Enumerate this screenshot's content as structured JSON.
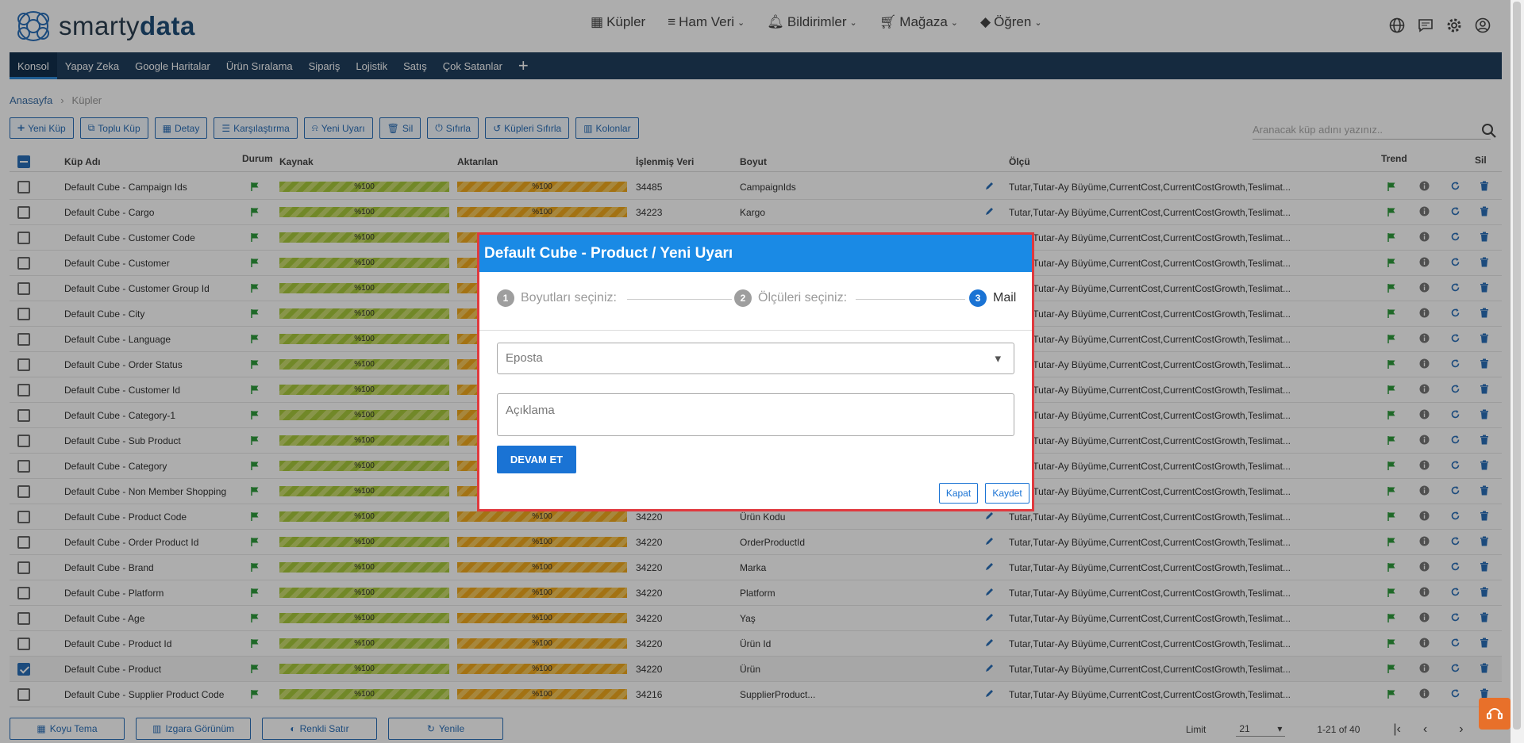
{
  "brand": {
    "logo_light": "smarty",
    "logo_bold": "data"
  },
  "topnav": [
    {
      "icon": "grid-icon",
      "label": "Küpler",
      "dropdown": false
    },
    {
      "icon": "list-icon",
      "label": "Ham Veri",
      "dropdown": true
    },
    {
      "icon": "bell-icon",
      "label": "Bildirimler",
      "dropdown": true
    },
    {
      "icon": "cart-icon",
      "label": "Mağaza",
      "dropdown": true
    },
    {
      "icon": "learn-icon",
      "label": "Öğren",
      "dropdown": true
    }
  ],
  "menu": [
    "Konsol",
    "Yapay Zeka",
    "Google Haritalar",
    "Ürün Sıralama",
    "Sipariş",
    "Lojistik",
    "Satış",
    "Çok Satanlar"
  ],
  "breadcrumb": {
    "home": "Anasayfa",
    "current": "Küpler"
  },
  "toolbar": [
    {
      "icon": "plus-icon",
      "label": "Yeni Küp"
    },
    {
      "icon": "copy-icon",
      "label": "Toplu Küp"
    },
    {
      "icon": "table-icon",
      "label": "Detay"
    },
    {
      "icon": "compare-icon",
      "label": "Karşılaştırma"
    },
    {
      "icon": "bell-icon",
      "label": "Yeni Uyarı"
    },
    {
      "icon": "trash-icon",
      "label": "Sil"
    },
    {
      "icon": "power-icon",
      "label": "Sıfırla"
    },
    {
      "icon": "history-icon",
      "label": "Küpleri Sıfırla"
    },
    {
      "icon": "columns-icon",
      "label": "Kolonlar"
    }
  ],
  "search": {
    "placeholder": "Aranacak küp adını yazınız.."
  },
  "columns": {
    "name": "Küp Adı",
    "status": "Durum",
    "source": "Kaynak",
    "transferred": "Aktarılan",
    "processed": "İşlenmiş Veri",
    "dimension": "Boyut",
    "measure": "Ölçü",
    "trend": "Trend",
    "delete": "Sil"
  },
  "rows": [
    {
      "name": "Default Cube - Campaign Ids",
      "source": "%100",
      "transferred": "%100",
      "processed": "34485",
      "dimension": "CampaignIds",
      "measure": "Tutar,Tutar-Ay Büyüme,CurrentCost,CurrentCostGrowth,Teslimat...",
      "checked": false
    },
    {
      "name": "Default Cube - Cargo",
      "source": "%100",
      "transferred": "%100",
      "processed": "34223",
      "dimension": "Kargo",
      "measure": "Tutar,Tutar-Ay Büyüme,CurrentCost,CurrentCostGrowth,Teslimat...",
      "checked": false
    },
    {
      "name": "Default Cube - Customer Code",
      "source": "%100",
      "transferred": "",
      "processed": "",
      "dimension": "",
      "measure": "Tutar,Tutar-Ay Büyüme,CurrentCost,CurrentCostGrowth,Teslimat...",
      "checked": false
    },
    {
      "name": "Default Cube - Customer",
      "source": "%100",
      "transferred": "",
      "processed": "",
      "dimension": "",
      "measure": "Tutar,Tutar-Ay Büyüme,CurrentCost,CurrentCostGrowth,Teslimat...",
      "checked": false
    },
    {
      "name": "Default Cube - Customer Group Id",
      "source": "%100",
      "transferred": "",
      "processed": "",
      "dimension": "",
      "measure": "Tutar,Tutar-Ay Büyüme,CurrentCost,CurrentCostGrowth,Teslimat...",
      "checked": false
    },
    {
      "name": "Default Cube - City",
      "source": "%100",
      "transferred": "",
      "processed": "",
      "dimension": "",
      "measure": "Tutar,Tutar-Ay Büyüme,CurrentCost,CurrentCostGrowth,Teslimat...",
      "checked": false
    },
    {
      "name": "Default Cube - Language",
      "source": "%100",
      "transferred": "",
      "processed": "",
      "dimension": "",
      "measure": "Tutar,Tutar-Ay Büyüme,CurrentCost,CurrentCostGrowth,Teslimat...",
      "checked": false
    },
    {
      "name": "Default Cube - Order Status",
      "source": "%100",
      "transferred": "",
      "processed": "",
      "dimension": "",
      "measure": "Tutar,Tutar-Ay Büyüme,CurrentCost,CurrentCostGrowth,Teslimat...",
      "checked": false
    },
    {
      "name": "Default Cube - Customer Id",
      "source": "%100",
      "transferred": "",
      "processed": "",
      "dimension": "",
      "measure": "Tutar,Tutar-Ay Büyüme,CurrentCost,CurrentCostGrowth,Teslimat...",
      "checked": false
    },
    {
      "name": "Default Cube - Category-1",
      "source": "%100",
      "transferred": "",
      "processed": "",
      "dimension": "",
      "measure": "Tutar,Tutar-Ay Büyüme,CurrentCost,CurrentCostGrowth,Teslimat...",
      "checked": false
    },
    {
      "name": "Default Cube - Sub Product",
      "source": "%100",
      "transferred": "",
      "processed": "",
      "dimension": "",
      "measure": "Tutar,Tutar-Ay Büyüme,CurrentCost,CurrentCostGrowth,Teslimat...",
      "checked": false
    },
    {
      "name": "Default Cube - Category",
      "source": "%100",
      "transferred": "",
      "processed": "",
      "dimension": "",
      "measure": "Tutar,Tutar-Ay Büyüme,CurrentCost,CurrentCostGrowth,Teslimat...",
      "checked": false
    },
    {
      "name": "Default Cube - Non Member Shopping",
      "source": "%100",
      "transferred": "",
      "processed": "",
      "dimension": "",
      "measure": "Tutar,Tutar-Ay Büyüme,CurrentCost,CurrentCostGrowth,Teslimat...",
      "checked": false
    },
    {
      "name": "Default Cube - Product Code",
      "source": "%100",
      "transferred": "%100",
      "processed": "34220",
      "dimension": "Ürün Kodu",
      "measure": "Tutar,Tutar-Ay Büyüme,CurrentCost,CurrentCostGrowth,Teslimat...",
      "checked": false
    },
    {
      "name": "Default Cube - Order Product Id",
      "source": "%100",
      "transferred": "%100",
      "processed": "34220",
      "dimension": "OrderProductId",
      "measure": "Tutar,Tutar-Ay Büyüme,CurrentCost,CurrentCostGrowth,Teslimat...",
      "checked": false
    },
    {
      "name": "Default Cube - Brand",
      "source": "%100",
      "transferred": "%100",
      "processed": "34220",
      "dimension": "Marka",
      "measure": "Tutar,Tutar-Ay Büyüme,CurrentCost,CurrentCostGrowth,Teslimat...",
      "checked": false
    },
    {
      "name": "Default Cube - Platform",
      "source": "%100",
      "transferred": "%100",
      "processed": "34220",
      "dimension": "Platform",
      "measure": "Tutar,Tutar-Ay Büyüme,CurrentCost,CurrentCostGrowth,Teslimat...",
      "checked": false
    },
    {
      "name": "Default Cube - Age",
      "source": "%100",
      "transferred": "%100",
      "processed": "34220",
      "dimension": "Yaş",
      "measure": "Tutar,Tutar-Ay Büyüme,CurrentCost,CurrentCostGrowth,Teslimat...",
      "checked": false
    },
    {
      "name": "Default Cube - Product Id",
      "source": "%100",
      "transferred": "%100",
      "processed": "34220",
      "dimension": "Ürün Id",
      "measure": "Tutar,Tutar-Ay Büyüme,CurrentCost,CurrentCostGrowth,Teslimat...",
      "checked": false
    },
    {
      "name": "Default Cube - Product",
      "source": "%100",
      "transferred": "%100",
      "processed": "34220",
      "dimension": "Ürün",
      "measure": "Tutar,Tutar-Ay Büyüme,CurrentCost,CurrentCostGrowth,Teslimat...",
      "checked": true
    },
    {
      "name": "Default Cube - Supplier Product Code",
      "source": "%100",
      "transferred": "%100",
      "processed": "34216",
      "dimension": "SupplierProduct...",
      "measure": "Tutar,Tutar-Ay Büyüme,CurrentCost,CurrentCostGrowth,Teslimat...",
      "checked": false
    }
  ],
  "footer": {
    "buttons": [
      "Koyu Tema",
      "Izgara Görünüm",
      "Renkli Satır",
      "Yenile"
    ],
    "limit_label": "Limit",
    "limit_value": "21",
    "range": "1-21 of 40"
  },
  "modal": {
    "title": "Default Cube - Product / Yeni Uyarı",
    "steps": [
      {
        "num": "1",
        "label": "Boyutları seçiniz:"
      },
      {
        "num": "2",
        "label": "Ölçüleri seçiniz:"
      },
      {
        "num": "3",
        "label": "Mail"
      }
    ],
    "email_placeholder": "Eposta",
    "description_placeholder": "Açıklama",
    "continue_label": "DEVAM ET",
    "close_label": "Kapat",
    "save_label": "Kaydet"
  },
  "colors": {
    "accent": "#1a8ae5",
    "menubar": "#1f3e5e",
    "modal_border": "#e0393e",
    "flag": "#2e9b3c",
    "source_bar": "#a7c93c",
    "transferred_bar": "#f0a81d"
  }
}
